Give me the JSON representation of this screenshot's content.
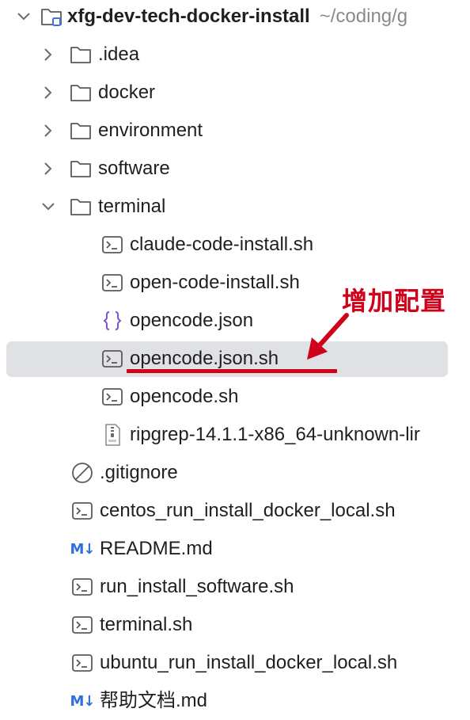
{
  "project": {
    "name": "xfg-dev-tech-docker-install",
    "path_hint": "~/coding/g"
  },
  "tree": {
    "idea": ".idea",
    "docker": "docker",
    "environment": "environment",
    "software": "software",
    "terminal": "terminal",
    "terminal_children": {
      "claude_install": "claude-code-install.sh",
      "open_install": "open-code-install.sh",
      "opencode_json": "opencode.json",
      "opencode_json_sh": "opencode.json.sh",
      "opencode_sh": "opencode.sh",
      "ripgrep": "ripgrep-14.1.1-x86_64-unknown-lir"
    },
    "gitignore": ".gitignore",
    "centos_run": "centos_run_install_docker_local.sh",
    "readme": "README.md",
    "run_install": "run_install_software.sh",
    "terminal_sh": "terminal.sh",
    "ubuntu_run": "ubuntu_run_install_docker_local.sh",
    "help_doc": "帮助文档.md"
  },
  "icons": {
    "markdown_badge": "M↓",
    "json_braces": "{}"
  },
  "annotation": {
    "text": "增加配置",
    "color": "#d0021b"
  },
  "colors": {
    "selected_row": "#dfe1e5",
    "markdown_blue": "#2f6fdc",
    "json_purple": "#7b52d6"
  }
}
